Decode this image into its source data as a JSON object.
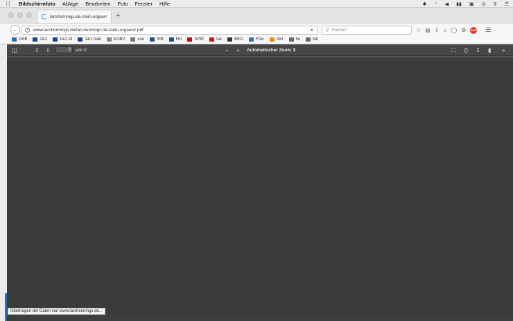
{
  "menubar": {
    "apple": "",
    "app_name": "Bildschirmfoto",
    "items": [
      "Ablage",
      "Bearbeiten",
      "Foto",
      "Fenster",
      "Hilfe"
    ],
    "status_icons": [
      "bluetooth-icon",
      "wifi-icon",
      "volume-icon",
      "battery-icon",
      "display-icon",
      "time-machine-icon",
      "spotlight-icon",
      "notification-center-icon"
    ]
  },
  "tab": {
    "title": "larshennings.de-stein-ergaenz",
    "close": "×"
  },
  "newtab": "+",
  "navbar": {
    "back": "←",
    "url": "www.larshennings.de/larshennings.de-stein-ergaenz.pdf",
    "stop": "×",
    "search_placeholder": "Suchen",
    "abp": "ABP"
  },
  "bookmarks": [
    {
      "label": "DKB",
      "icon": "dkb-icon",
      "color": "#2a6bb5"
    },
    {
      "label": "1&1",
      "icon": "1und1-icon",
      "color": "#1c3f94"
    },
    {
      "label": "1&1 stl",
      "icon": "1und1-icon",
      "color": "#1c3f94"
    },
    {
      "label": "1&1 mail",
      "icon": "1und1-icon",
      "color": "#1c3f94"
    },
    {
      "label": "KOBV",
      "icon": "dots-icon",
      "color": "#888888"
    },
    {
      "label": "voe",
      "icon": "dash-icon",
      "color": "#777777"
    },
    {
      "label": "StB",
      "icon": "stb-icon",
      "color": "#2a4a8a"
    },
    {
      "label": "HU",
      "icon": "hu-icon",
      "color": "#1f4c8f"
    },
    {
      "label": "SPIE",
      "icon": "spiegel-icon",
      "color": "#d0021b"
    },
    {
      "label": "taz",
      "icon": "taz-icon",
      "color": "#c4161c"
    },
    {
      "label": "BEO",
      "icon": "beo-icon",
      "color": "#333333"
    },
    {
      "label": "FDic",
      "icon": "fdic-icon",
      "color": "#3c6fb5"
    },
    {
      "label": "dict",
      "icon": "dict-icon",
      "color": "#f08a00"
    },
    {
      "label": "ho",
      "icon": "ho-icon",
      "color": "#666666"
    },
    {
      "label": "bik",
      "icon": "gear-icon",
      "color": "#666666"
    }
  ],
  "pdf": {
    "page_number": "0",
    "page_count": "von 0",
    "zoom_minus": "−",
    "zoom_plus": "+",
    "zoom_label": "Automatischer Zoom",
    "zoom_arrow": "⇕"
  },
  "status": "Übertragen der Daten von www.larshennings.de..."
}
